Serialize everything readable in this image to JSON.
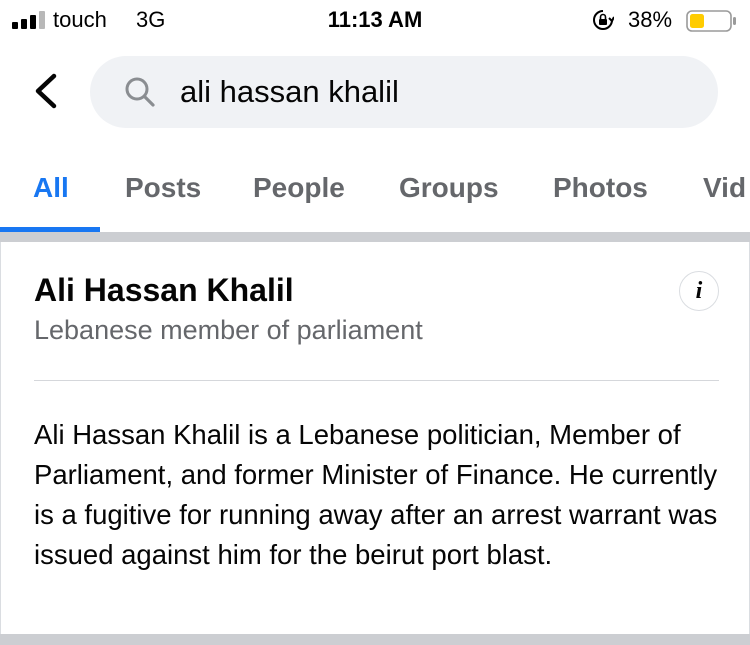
{
  "status_bar": {
    "carrier": "touch",
    "network": "3G",
    "time": "11:13 AM",
    "battery_percent": "38%",
    "battery_level": 0.38,
    "battery_color": "#ffcc00"
  },
  "search": {
    "query": "ali hassan khalil",
    "icon": "search-icon"
  },
  "tabs": [
    {
      "label": "All",
      "active": true
    },
    {
      "label": "Posts",
      "active": false
    },
    {
      "label": "People",
      "active": false
    },
    {
      "label": "Groups",
      "active": false
    },
    {
      "label": "Photos",
      "active": false
    },
    {
      "label": "Vid",
      "active": false
    }
  ],
  "accent_color": "#1877f2",
  "result_card": {
    "name": "Ali Hassan Khalil",
    "subtitle": "Lebanese member of parliament",
    "info_icon": "info-icon",
    "description": "Ali Hassan Khalil is a Lebanese politician, Member of Parliament, and former Minister of Finance. He currently is a fugitive for running away after an arrest warrant was issued against him for the beirut port blast."
  }
}
